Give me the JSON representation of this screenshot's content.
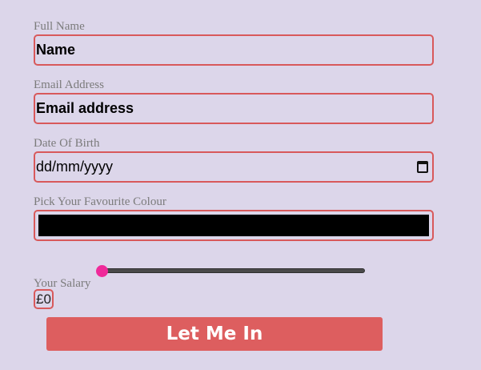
{
  "form": {
    "full_name": {
      "label": "Full Name",
      "value": "Name"
    },
    "email": {
      "label": "Email Address",
      "value": "Email address"
    },
    "dob": {
      "label": "Date Of Birth",
      "value": "dd/mm/yyyy",
      "icon": "calendar-icon"
    },
    "colour": {
      "label": "Pick Your Favourite Colour",
      "value": "#000000"
    },
    "salary": {
      "label": "Your Salary",
      "value": 0,
      "display": "£0"
    },
    "submit_label": "Let Me In"
  },
  "colors": {
    "background": "#dcd6ea",
    "accent": "#dd5e5f",
    "border": "#d8595b",
    "slider_thumb": "#ef2a9a"
  }
}
